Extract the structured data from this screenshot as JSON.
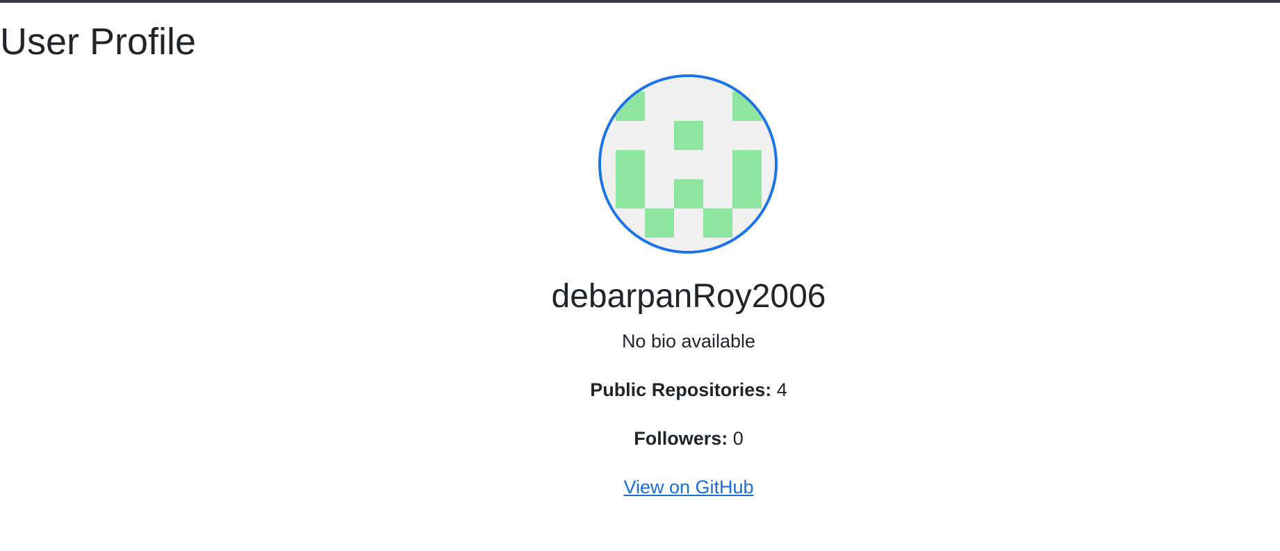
{
  "page": {
    "title": "User Profile"
  },
  "profile": {
    "username": "debarpanRoy2006",
    "bio": "No bio available",
    "public_repos_label": "Public Repositories:",
    "public_repos_value": "4",
    "followers_label": "Followers:",
    "followers_value": "0",
    "github_link_label": "View on GitHub",
    "avatar_icon": "identicon-avatar"
  },
  "colors": {
    "avatar_border": "#1a73e8",
    "identicon_fill": "#8ee59f",
    "identicon_background": "#f0f0f0",
    "link": "#1a6ed8",
    "top_bar": "#343a40"
  }
}
